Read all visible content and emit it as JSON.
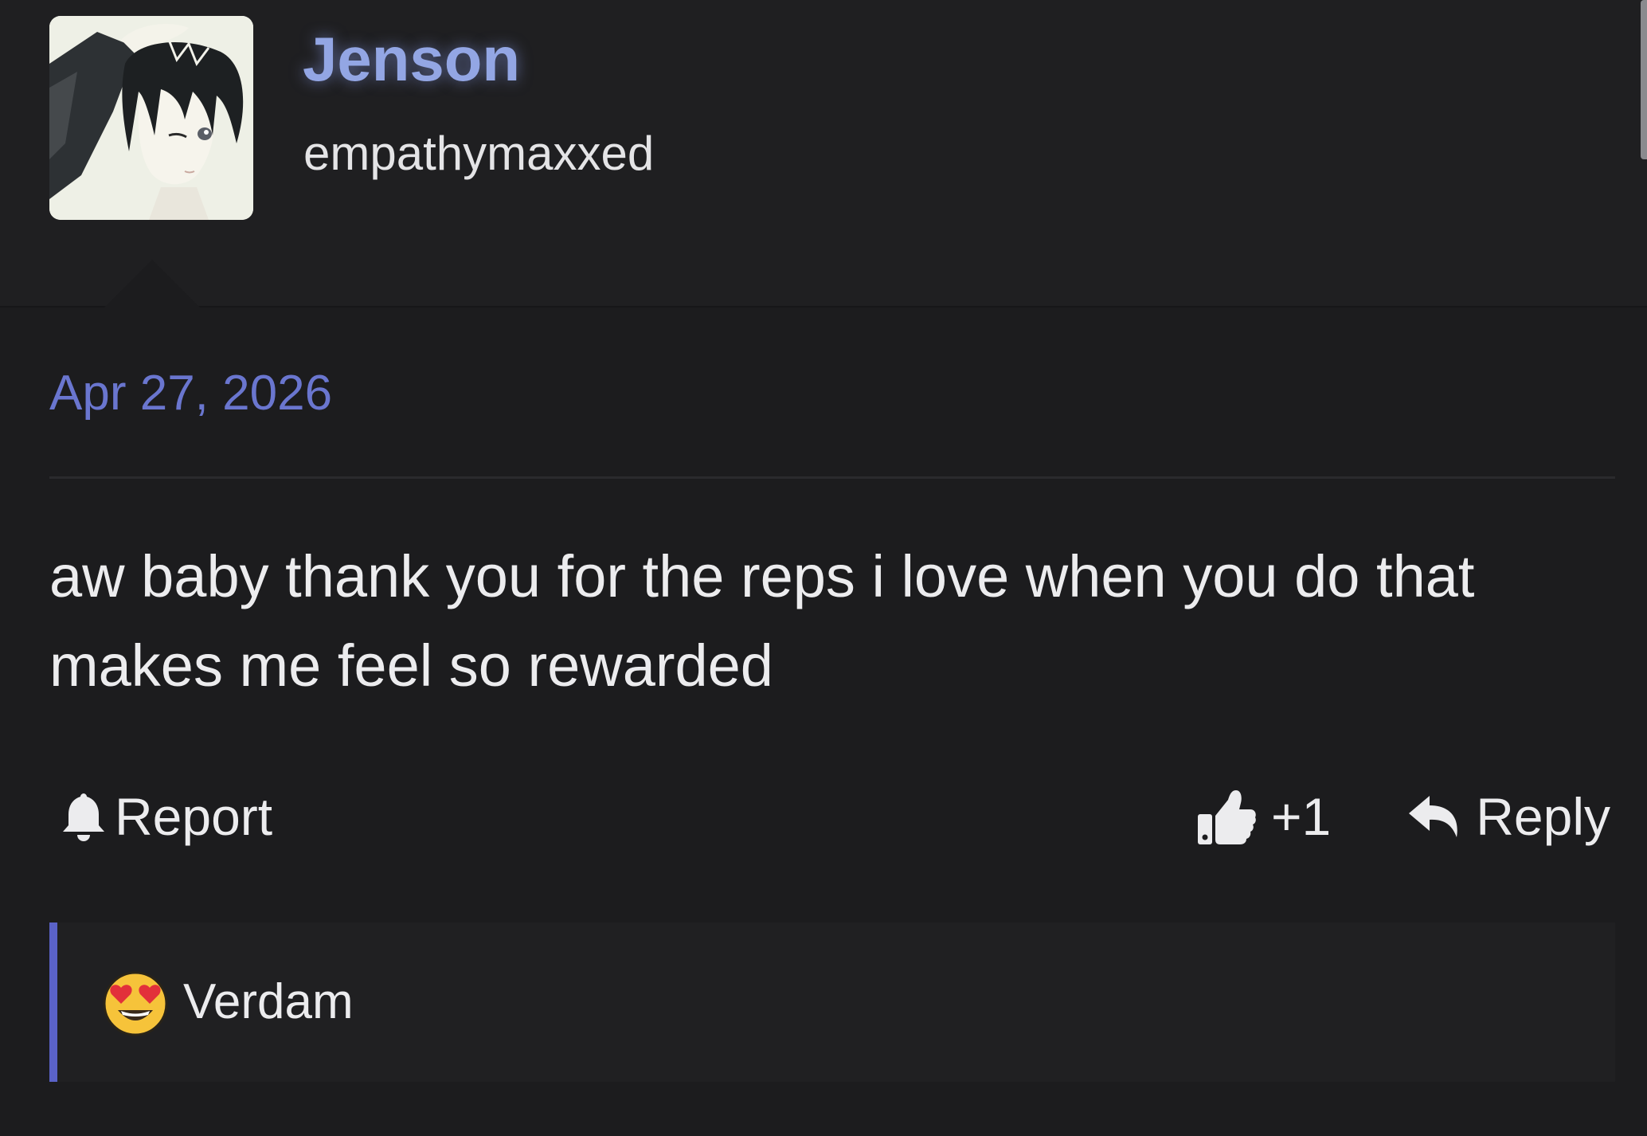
{
  "author": {
    "name": "Jenson",
    "title": "empathymaxxed",
    "avatar_icon": "anime-avatar"
  },
  "post": {
    "date": "Apr 27, 2026",
    "message": "aw baby thank you for the reps i love when you do that makes me feel so rewarded"
  },
  "actions": {
    "report_label": "Report",
    "report_icon": "bell-icon",
    "like_count": "+1",
    "like_icon": "thumbs-up-icon",
    "reply_label": "Reply",
    "reply_icon": "reply-arrow-icon"
  },
  "reactions": [
    {
      "emoji": "heart-eyes-emoji",
      "user": "Verdam"
    }
  ],
  "colors": {
    "background": "#1c1c1e",
    "username": "#93a6e4",
    "date": "#6a76cf",
    "accent_bar": "#5a62c8"
  }
}
